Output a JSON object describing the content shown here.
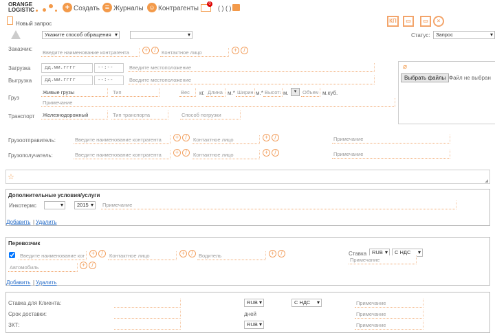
{
  "header": {
    "logo_line1": "ORANGE",
    "logo_line2": "LOGISTIC",
    "create": "Создать",
    "journals": "Журналы",
    "contractors": "Контрагенты",
    "mail_count": "0",
    "parens": "( ) ( )"
  },
  "page": {
    "title": "Новый запрос",
    "status_label": "Статус:",
    "status_value": "Запрос",
    "contact_method": "Укажите способ обращения",
    "contact_method2": "",
    "kp_label": "КП"
  },
  "customer": {
    "label": "Заказчик:",
    "name_ph": "Введите наименование контрагента",
    "contact_ph": "Контактное лицо"
  },
  "loading": {
    "label": "Загрузка",
    "date_ph": "дд.мм.гггг",
    "time_ph": "--:--",
    "loc_ph": "Введите местоположение"
  },
  "unloading": {
    "label": "Выгрузка",
    "date_ph": "дд.мм.гггг",
    "time_ph": "--:--",
    "loc_ph": "Введите местоположение"
  },
  "cargo": {
    "label": "Груз",
    "name": "Живые грузы",
    "type_ph": "Тип",
    "weight_ph": "Вес",
    "kg": "кг.",
    "length_ph": "Длина",
    "m1": "м.*",
    "width_ph": "Ширина",
    "m2": "м.*",
    "height_ph": "Высота",
    "m3": "м.",
    "volume_ph": "Объем",
    "m3cub": "м.куб.",
    "note_ph": "Примечание"
  },
  "transport": {
    "label": "Транспорт",
    "name": "Железнодорожный",
    "type_ph": "Тип транспорта",
    "loading_ph": "Способ погрузки"
  },
  "files": {
    "button": "Выбрать файлы",
    "status": "Файл не выбран"
  },
  "shipper": {
    "label": "Грузоотправитель:",
    "name_ph": "Введите наименование контрагента",
    "contact_ph": "Контактное лицо",
    "note_ph": "Примечание"
  },
  "consignee": {
    "label": "Грузополучатель:",
    "name_ph": "Введите наименование контрагента",
    "contact_ph": "Контактное лицо",
    "note_ph": "Примечание"
  },
  "extra": {
    "title": "Дополнительные условия/услуги",
    "incoterms_label": "Инкотермс",
    "incoterms_value": "",
    "year": "2015",
    "note_ph": "Примечание",
    "add": "Добавить",
    "sep": "|",
    "remove": "Удалить"
  },
  "carrier": {
    "title": "Перевозчик",
    "checked": true,
    "name_ph": "Введите наименование кон",
    "contact_ph": "Контактное лицо",
    "driver_ph": "Водитель",
    "car_ph": "Автомобиль",
    "rate_label": "Ставка",
    "currency": "RUB",
    "vat": "С НДС",
    "note_ph": "Примечание",
    "add": "Добавить",
    "sep": "|",
    "remove": "Удалить"
  },
  "rates": [
    {
      "label": "Ставка для Клиента:",
      "currency": "RUB",
      "vat": "С НДС",
      "note_ph": "Примечание"
    },
    {
      "label": "Срок доставки:",
      "unit": "дней",
      "note_ph": "Примечание"
    },
    {
      "label": "ЗКТ:",
      "currency": "RUB",
      "note_ph": "Примечание"
    }
  ],
  "colors": {
    "accent": "#f39a4a",
    "link": "#2a6fc9"
  }
}
